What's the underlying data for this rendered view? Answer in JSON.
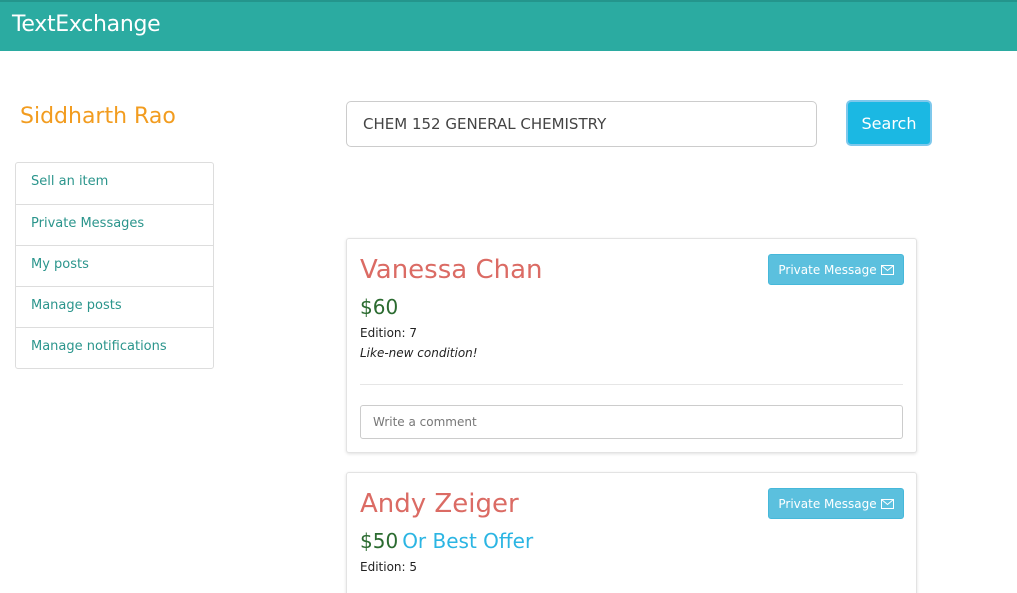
{
  "app": {
    "brand": "TextExchange"
  },
  "user": {
    "name": "Siddharth Rao"
  },
  "sidebar": {
    "items": [
      {
        "label": "Sell an item"
      },
      {
        "label": "Private Messages"
      },
      {
        "label": "My posts"
      },
      {
        "label": "Manage posts"
      },
      {
        "label": "Manage notifications"
      }
    ]
  },
  "search": {
    "value": "CHEM 152 GENERAL CHEMISTRY",
    "button_label": "Search"
  },
  "posts": [
    {
      "seller": "Vanessa Chan",
      "price": "$60",
      "offer": "",
      "edition_label": "Edition: ",
      "edition": "7",
      "condition": "Like-new condition!",
      "pm_label": "Private Message",
      "comment_placeholder": "Write a comment"
    },
    {
      "seller": "Andy Zeiger",
      "price": "$50",
      "offer": "Or Best Offer",
      "edition_label": "Edition: ",
      "edition": "5",
      "pm_label": "Private Message"
    }
  ],
  "colors": {
    "navbar": "#2baba1",
    "username": "#f29c1f",
    "seller": "#db6b64",
    "price": "#2b6b30",
    "offer": "#2bb5e3",
    "search_button": "#1bb8e3",
    "pm_button": "#5bc0de"
  },
  "icons": {
    "pm": "envelope-icon"
  }
}
